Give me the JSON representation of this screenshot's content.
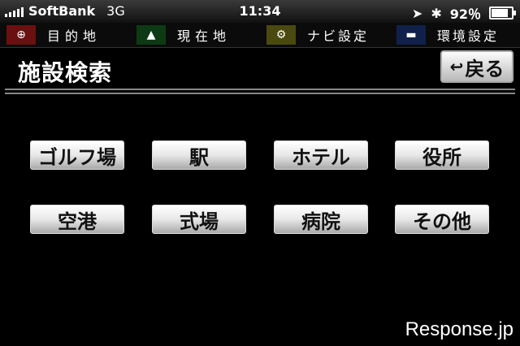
{
  "status_bar": {
    "carrier": "SoftBank",
    "network": "3G",
    "time": "11:34",
    "battery_percent": "92％",
    "battery_level": 0.92
  },
  "nav": {
    "tabs": [
      {
        "label": "目的地",
        "icon": "search-icon",
        "color": "#6a1010"
      },
      {
        "label": "現在地",
        "icon": "location-arrow-icon",
        "color": "#0d3a14"
      },
      {
        "label": "ナビ設定",
        "icon": "navi-settings-icon",
        "color": "#4a4a10"
      },
      {
        "label": "環境設定",
        "icon": "settings-icon",
        "color": "#10204a"
      }
    ]
  },
  "header": {
    "title": "施設検索",
    "back_label": "戻る"
  },
  "facilities": [
    {
      "label": "ゴルフ場"
    },
    {
      "label": "駅"
    },
    {
      "label": "ホテル"
    },
    {
      "label": "役所"
    },
    {
      "label": "空港"
    },
    {
      "label": "式場"
    },
    {
      "label": "病院"
    },
    {
      "label": "その他"
    }
  ],
  "watermark": "Response.jp"
}
